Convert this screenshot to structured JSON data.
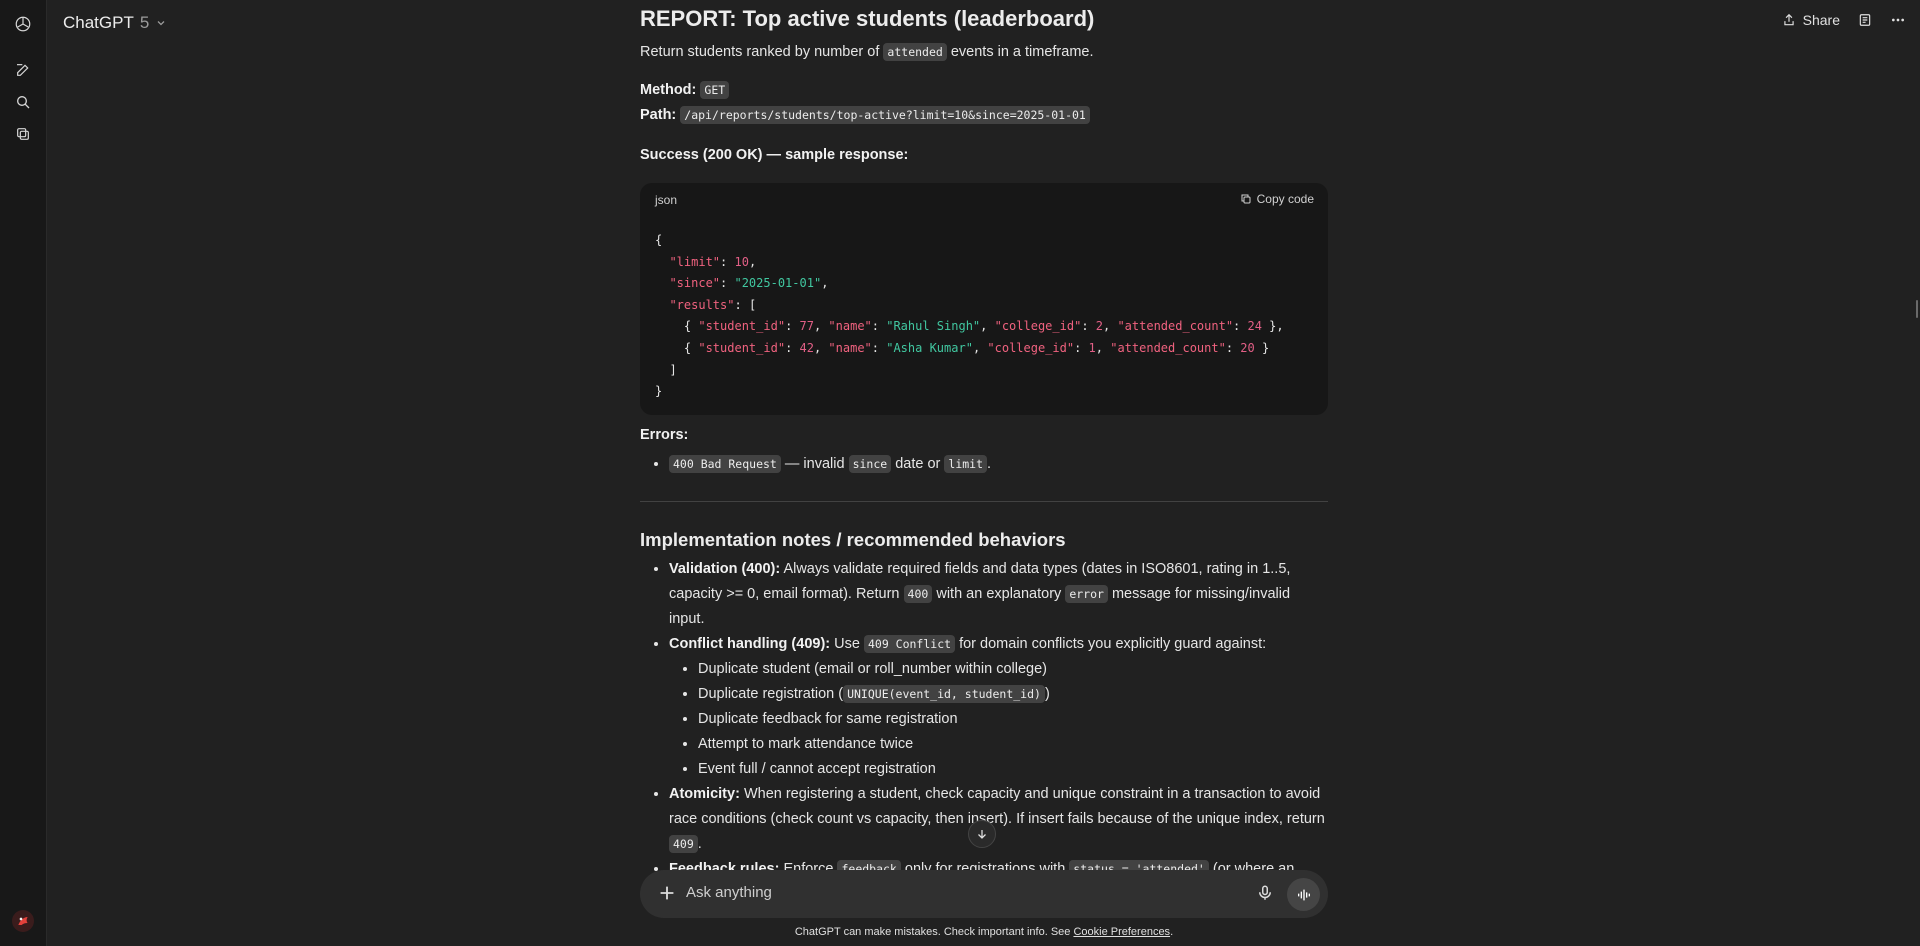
{
  "app": {
    "model_name": "ChatGPT",
    "model_version": "5"
  },
  "top_actions": {
    "share_label": "Share"
  },
  "report": {
    "title": "REPORT: Top active students (leaderboard)",
    "desc_pre": "Return students ranked by number of",
    "desc_code": "attended",
    "desc_post": "events in a timeframe.",
    "method_label": "Method:",
    "method_value": "GET",
    "path_label": "Path:",
    "path_value": "/api/reports/students/top-active?limit=10&since=2025-01-01",
    "success_label": "Success (200 OK) — sample response:",
    "code_lang": "json",
    "copy_label": "Copy code",
    "errors_label": "Errors:",
    "error_code": "400 Bad Request",
    "error_text_1": "— invalid",
    "error_since": "since",
    "error_text_2": "date or",
    "error_limit": "limit",
    "error_text_3": "."
  },
  "json_sample": {
    "l0": "{",
    "limit_key": "\"limit\"",
    "limit_val": "10",
    "since_key": "\"since\"",
    "since_val": "\"2025-01-01\"",
    "results_key": "\"results\"",
    "open_bracket": "[",
    "rows": [
      {
        "student_id": "77",
        "name": "\"Rahul Singh\"",
        "college_id": "2",
        "attended_count": "24",
        "tail": " },"
      },
      {
        "student_id": "42",
        "name": "\"Asha Kumar\"",
        "college_id": "1",
        "attended_count": "20",
        "tail": " }"
      }
    ],
    "k_student_id": "\"student_id\"",
    "k_name": "\"name\"",
    "k_college_id": "\"college_id\"",
    "k_attended_count": "\"attended_count\"",
    "close_bracket": "]",
    "l_end": "}"
  },
  "notes": {
    "title": "Implementation notes / recommended behaviors",
    "validation_label": "Validation (400):",
    "validation_text_1": "Always validate required fields and data types (dates in ISO8601, rating in 1..5, capacity >= 0, email format). Return",
    "validation_code": "400",
    "validation_text_2": "with an explanatory",
    "validation_code_2": "error",
    "validation_text_3": "message for missing/invalid input.",
    "conflict_label": "Conflict handling (409):",
    "conflict_text_1": "Use",
    "conflict_code": "409 Conflict",
    "conflict_text_2": "for domain conflicts you explicitly guard against:",
    "conflict_items": [
      "Duplicate student (email or roll_number within college)",
      "Duplicate registration (",
      "Duplicate feedback for same registration",
      "Attempt to mark attendance twice",
      "Event full / cannot accept registration"
    ],
    "dup_reg_code": "UNIQUE(event_id, student_id)",
    "dup_reg_close": ")",
    "atomicity_label": "Atomicity:",
    "atomicity_text": "When registering a student, check capacity and unique constraint in a transaction to avoid race conditions (check count vs capacity, then insert). If insert fails because of the unique index, return",
    "atomicity_code": "409",
    "atomicity_end": ".",
    "feedback_label": "Feedback rules:",
    "feedback_text_1": "Enforce",
    "feedback_code": "feedback",
    "feedback_text_2": "only for registrations with",
    "feedback_code_2": "status = 'attended'",
    "feedback_text_3": "(or where an"
  },
  "composer": {
    "placeholder": "Ask anything"
  },
  "footer": {
    "text": "ChatGPT can make mistakes. Check important info. See",
    "link": "Cookie Preferences",
    "end": "."
  }
}
